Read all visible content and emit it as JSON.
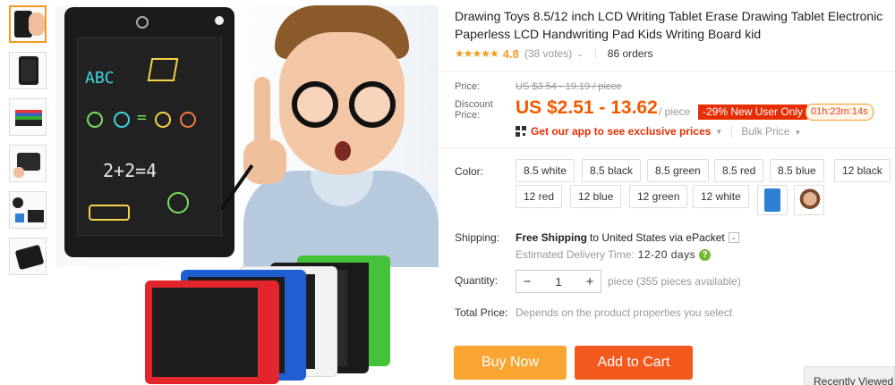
{
  "product": {
    "title": "Drawing Toys 8.5/12 inch LCD Writing Tablet Erase Drawing Tablet Electronic Paperless LCD Handwriting Pad Kids Writing Board kid"
  },
  "rating": {
    "stars": "★★★★★",
    "value": "4.8",
    "votes": "(38 votes)",
    "orders": "86 orders"
  },
  "price": {
    "price_label": "Price:",
    "old_price": "US $3.54 - 19.19 / piece",
    "discount_label_1": "Discount",
    "discount_label_2": "Price:",
    "discount_price": "US $2.51 - 13.62",
    "per_piece": "/ piece",
    "discount_badge": "-29% New User Only",
    "timer": "01h:23m:14s",
    "app_link": "Get our app to see exclusive prices",
    "bulk_price": "Bulk Price"
  },
  "sku": {
    "color_label": "Color:",
    "colors": [
      "8.5 white",
      "8.5 black",
      "8.5 green",
      "8.5 red",
      "8.5 blue",
      "12 black",
      "12 red",
      "12 blue",
      "12 green",
      "12 white"
    ]
  },
  "shipping": {
    "label": "Shipping:",
    "method": "Free Shipping",
    "destination": "to United States via ePacket",
    "eta_label": "Estimated Delivery Time:",
    "eta_value": "12-20 days",
    "help": "?"
  },
  "quantity": {
    "label": "Quantity:",
    "minus": "−",
    "value": "1",
    "plus": "+",
    "available": "piece (355 pieces available)"
  },
  "total": {
    "label": "Total Price:",
    "note": "Depends on the product properties you select"
  },
  "actions": {
    "buy_now": "Buy Now",
    "add_to_cart": "Add to Cart"
  },
  "side": {
    "recently_viewed": "Recently Viewed"
  },
  "image_art": {
    "board_doodles": [
      "ABC",
      "=",
      "2+2=4"
    ]
  },
  "colors_theme": {
    "accent": "#f15a00",
    "buy": "#f8a531",
    "cart": "#f3581d",
    "badge": "#e62e04",
    "star": "#f29c1f"
  }
}
